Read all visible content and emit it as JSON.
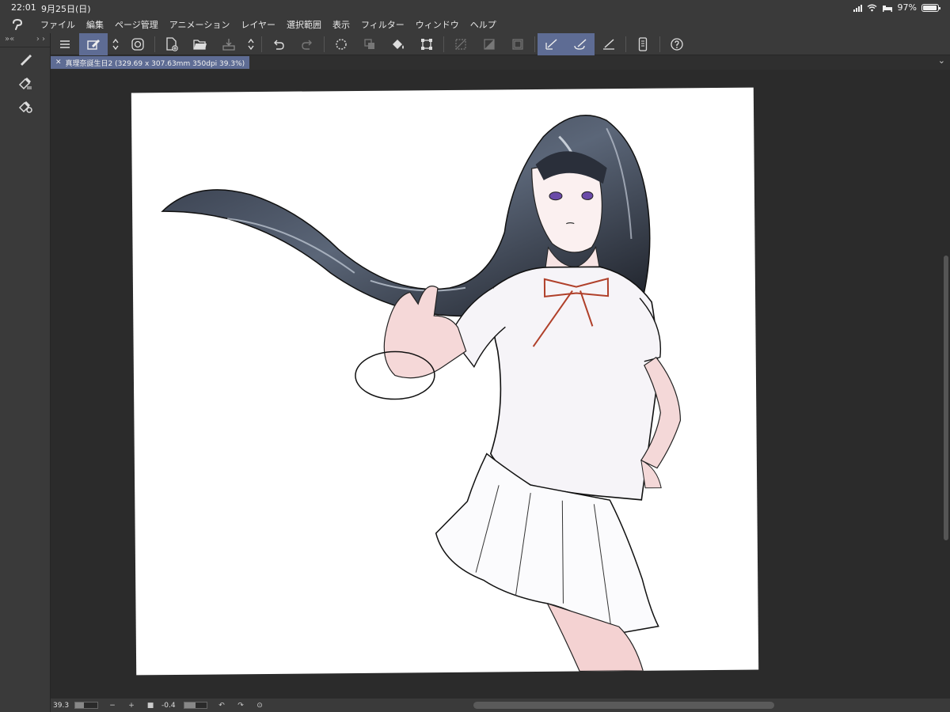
{
  "status": {
    "time": "22:01",
    "date": "9月25日(日)",
    "battery": "97%",
    "battery_level": 0.97
  },
  "menu": [
    "ファイル",
    "編集",
    "ページ管理",
    "アニメーション",
    "レイヤー",
    "選択範囲",
    "表示",
    "フィルター",
    "ウィンドウ",
    "ヘルプ"
  ],
  "document": {
    "tab_label": "真理奈誕生日2 (329.69 x 307.63mm 350dpi 39.3%)"
  },
  "bottom": {
    "zoom": "39.3",
    "rotation": "-0.4"
  },
  "colors": {
    "accent": "#5e6c94",
    "chrome": "#3a3a3a",
    "workspace": "#2b2b2b",
    "paper": "#ffffff"
  }
}
